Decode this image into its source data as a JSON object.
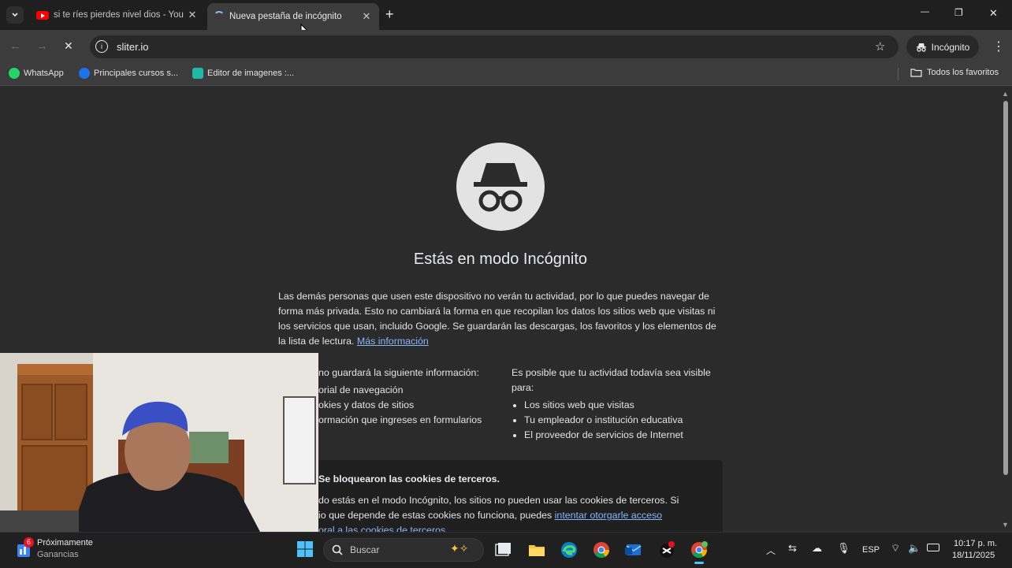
{
  "tabs": [
    {
      "title": "si te ríes pierdes nivel dios - You",
      "active": false,
      "favicon": "youtube-icon"
    },
    {
      "title": "Nueva pestaña de incógnito",
      "active": true,
      "favicon": "loading-spinner"
    }
  ],
  "new_tab_symbol": "+",
  "window_controls": {
    "minimize": "—",
    "restore": "❐",
    "close": "✕"
  },
  "address_bar": {
    "url": "sliter.io"
  },
  "profile_chip": {
    "label": "Incógnito"
  },
  "bookmarks": [
    {
      "label": "WhatsApp",
      "icon": "whatsapp-icon",
      "color": "#25d366"
    },
    {
      "label": "Principales cursos s...",
      "icon": "coursera-icon",
      "color": "#1a73e8"
    },
    {
      "label": "Editor de imagenes :...",
      "icon": "editor-icon",
      "color": "#22b8a6"
    }
  ],
  "bookmarks_folder": {
    "label": "Todos los favoritos"
  },
  "page": {
    "heading": "Estás en modo Incógnito",
    "intro": "Las demás personas que usen este dispositivo no verán tu actividad, por lo que puedes navegar de forma más privada. Esto no cambiará la forma en que recopilan los datos los sitios web que visitas ni los servicios que usan, incluido Google. Se guardarán las descargas, los favoritos y los elementos de la lista de lectura.",
    "more_info_link": "Más información",
    "left_col": {
      "title": "no guardará la siguiente información:",
      "items": [
        "orial de navegación",
        "okies y datos de sitios",
        "ormación que ingreses en formularios"
      ]
    },
    "right_col": {
      "title": "Es posible que tu actividad todavía sea visible para:",
      "items": [
        "Los sitios web que visitas",
        "Tu empleador o institución educativa",
        "El proveedor de servicios de Internet"
      ]
    },
    "cookie_card": {
      "title": "Se bloquearon las cookies de terceros.",
      "body_1": "do estás en el modo Incógnito, los sitios no pueden usar las cookies de terceros. Si",
      "body_2": "io que depende de estas cookies no funciona, puedes ",
      "link_1": "intentar otorgarle acceso",
      "link_2": "oral a las cookies de terceros"
    }
  },
  "taskbar": {
    "weather_title": "Próximamente",
    "weather_subtitle": "Ganancias",
    "notification_count": "6",
    "search_placeholder": "Buscar",
    "language": "ESP",
    "time": "10:17 p. m.",
    "date": "18/11/2025",
    "apps": [
      "windows-start-icon",
      "task-view-icon",
      "file-explorer-icon",
      "edge-icon",
      "chrome-icon",
      "outlook-icon",
      "capcut-icon",
      "chrome-incognito-icon"
    ]
  },
  "colors": {
    "accent_link": "#8ab4f8",
    "toolbar": "#3c3c3c",
    "tabstrip": "#1f1f1f",
    "page_bg": "#2b2b2b"
  }
}
